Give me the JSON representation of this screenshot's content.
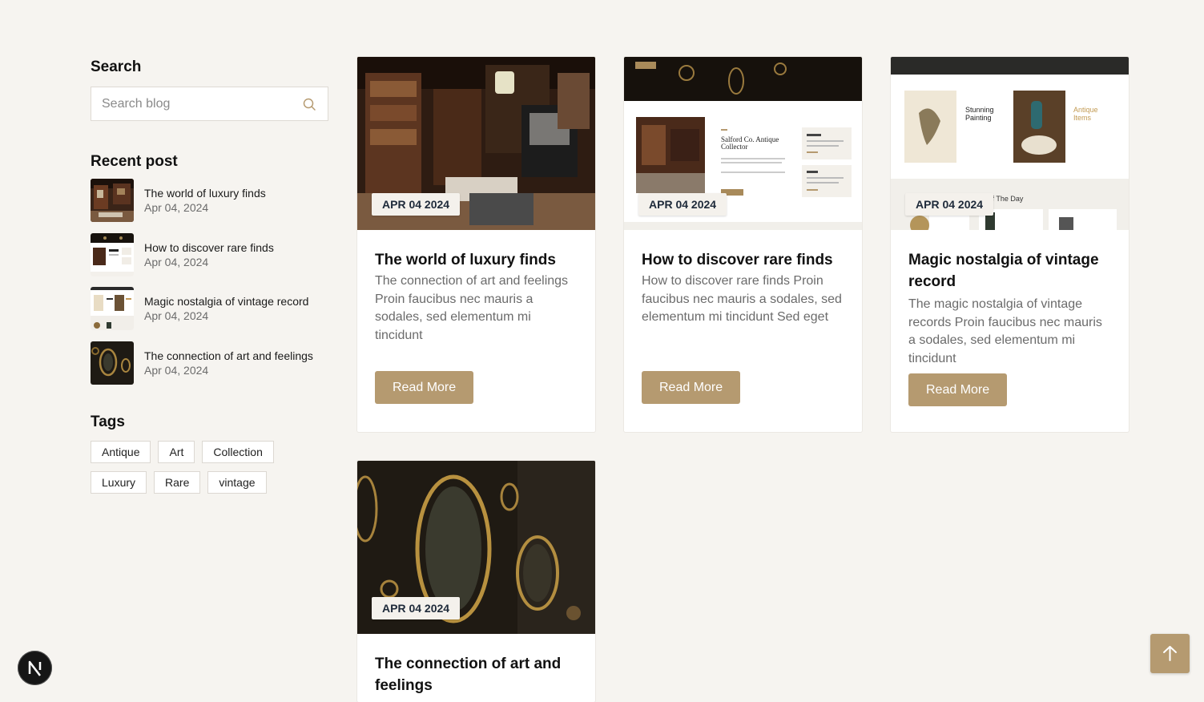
{
  "sidebar": {
    "search": {
      "title": "Search",
      "placeholder": "Search blog"
    },
    "recent": {
      "title": "Recent post",
      "items": [
        {
          "title": "The world of luxury finds",
          "date": "Apr 04, 2024"
        },
        {
          "title": "How to discover rare finds",
          "date": "Apr 04, 2024"
        },
        {
          "title": "Magic nostalgia of vintage record",
          "date": "Apr 04, 2024"
        },
        {
          "title": "The connection of art and feelings",
          "date": "Apr 04, 2024"
        }
      ]
    },
    "tags": {
      "title": "Tags",
      "items": [
        "Antique",
        "Art",
        "Collection",
        "Luxury",
        "Rare",
        "vintage"
      ]
    }
  },
  "posts": [
    {
      "date": "APR 04 2024",
      "title": "The world of luxury finds",
      "excerpt": "The connection of art and feelings Proin faucibus nec mauris a sodales, sed elementum mi tincidunt",
      "button": "Read More"
    },
    {
      "date": "APR 04 2024",
      "title": "How to discover rare finds",
      "excerpt": "How to discover rare finds Proin faucibus nec mauris a sodales, sed elementum mi tincidunt Sed eget",
      "button": "Read More"
    },
    {
      "date": "APR 04 2024",
      "title": "Magic nostalgia of vintage record",
      "excerpt": "The magic nostalgia of vintage records Proin faucibus nec mauris a sodales, sed elementum mi tincidunt",
      "button": "Read More"
    },
    {
      "date": "APR 04 2024",
      "title": "The connection of art and feelings",
      "excerpt": "",
      "button": ""
    }
  ],
  "thumb_texts": {
    "post2": {
      "heading": "Salford Co. Antique Collector"
    },
    "post3": {
      "painting": "Stunning Painting",
      "antique": "Antique Items",
      "deals": "Deals of The Day"
    }
  },
  "colors": {
    "accent": "#b59a70",
    "page_bg": "#f6f4f0",
    "badge_text": "#1e2a3a"
  },
  "icons": {
    "search": "search-icon",
    "back_to_top": "arrow-up-icon",
    "logo": "n-logo-icon"
  }
}
